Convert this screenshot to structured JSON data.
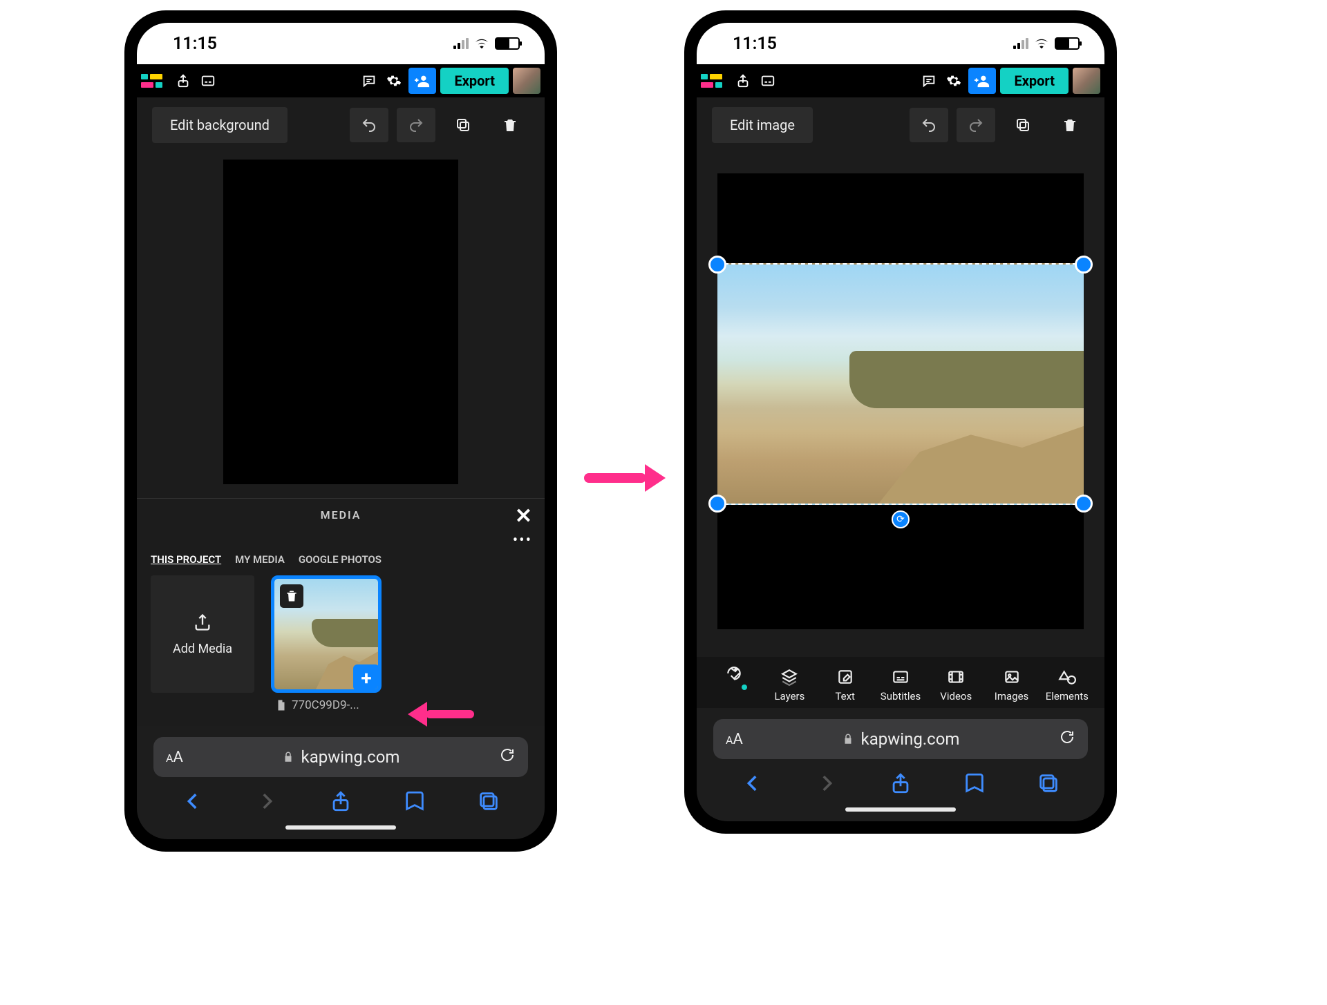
{
  "status": {
    "time": "11:15"
  },
  "topbar": {
    "export_label": "Export"
  },
  "screen1": {
    "edit_btn": "Edit background",
    "media_panel": {
      "title": "MEDIA",
      "tabs": {
        "this_project": "THIS PROJECT",
        "my_media": "MY MEDIA",
        "google_photos": "GOOGLE PHOTOS"
      },
      "add_media": "Add Media",
      "thumb_filename": "770C99D9-..."
    }
  },
  "screen2": {
    "edit_btn": "Edit image",
    "bottom_tabs": {
      "layers": "Layers",
      "text": "Text",
      "subtitles": "Subtitles",
      "videos": "Videos",
      "images": "Images",
      "elements": "Elements"
    }
  },
  "safari": {
    "url": "kapwing.com",
    "aa": "AA"
  }
}
